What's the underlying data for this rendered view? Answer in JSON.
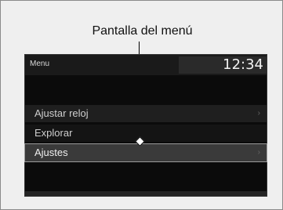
{
  "callout": {
    "label": "Pantalla del menú"
  },
  "screen": {
    "title": "Menu",
    "clock": "12:34",
    "items": [
      {
        "label": "Ajustar reloj"
      },
      {
        "label": "Explorar"
      },
      {
        "label": "Ajustes"
      }
    ],
    "selected_item": "Ajustes"
  },
  "icons": {
    "chevron": "chevron-right-icon",
    "leader_marker": "diamond-marker"
  }
}
